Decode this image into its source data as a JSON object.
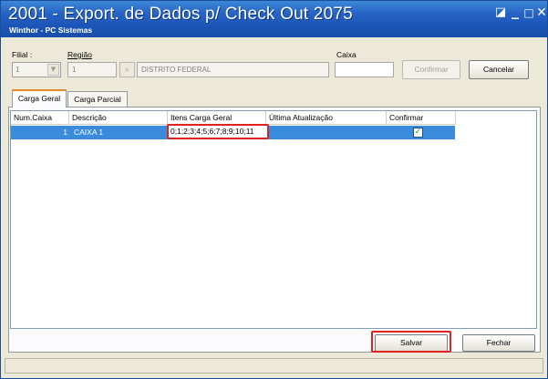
{
  "window": {
    "title": "2001 - Export. de Dados p/ Check Out 2075",
    "subtitle": "Winthor - PC Sistemas",
    "controls": {
      "pin": "◪",
      "minimize": "_",
      "maximize": "□",
      "close": "✕"
    }
  },
  "form": {
    "filial_label": "Filial :",
    "filial_value": "1",
    "regiao_label": "Região",
    "regiao_code": "1",
    "regiao_name": "DISTRITO FEDERAL",
    "caixa_label": "Caixa",
    "caixa_value": "",
    "confirmar_label": "Confirmar",
    "cancelar_label": "Cancelar"
  },
  "tabs": [
    {
      "label": "Carga Geral",
      "active": true
    },
    {
      "label": "Carga Parcial",
      "active": false
    }
  ],
  "grid": {
    "columns": [
      "Num.Caixa",
      "Descrição",
      "Itens Carga Geral",
      "Última Atualização",
      "Confirmar"
    ],
    "rows": [
      {
        "num_caixa": "1",
        "descricao": "CAIXA 1",
        "itens": "0;1;2;3;4;5;6;7;8;9;10;11",
        "ultima_atualizacao": "",
        "confirmar": true
      }
    ]
  },
  "buttons": {
    "salvar": "Salvar",
    "fechar": "Fechar"
  },
  "colors": {
    "titlebar": "#2663c4",
    "selection": "#3b8bdc",
    "highlight": "#e0231c",
    "tab_accent": "#e68b2c"
  }
}
